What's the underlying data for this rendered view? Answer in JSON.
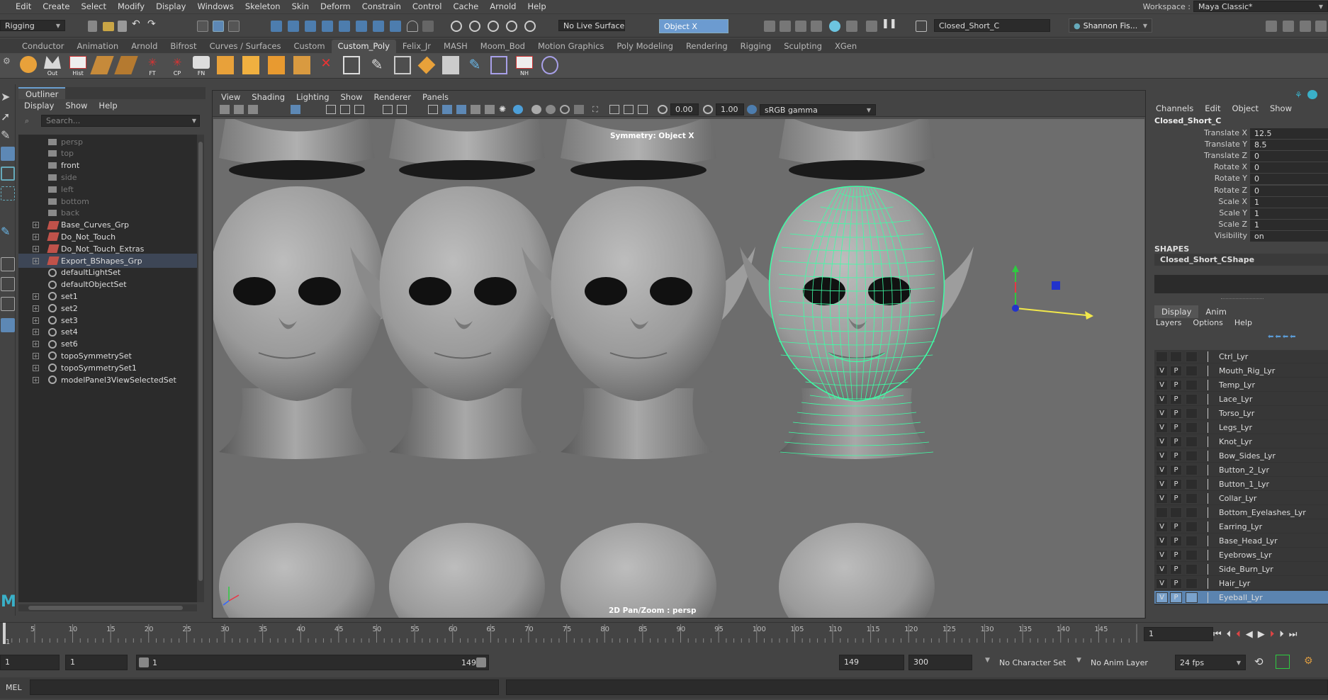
{
  "menubar": {
    "items": [
      "Edit",
      "Create",
      "Select",
      "Modify",
      "Display",
      "Windows",
      "Skeleton",
      "Skin",
      "Deform",
      "Constrain",
      "Control",
      "Cache",
      "Arnold",
      "Help"
    ],
    "workspace_label": "Workspace :",
    "workspace_value": "Maya Classic*"
  },
  "statusline": {
    "menuset": "Rigging",
    "live_surface": "No Live Surface",
    "symmetry": "Object X",
    "object_name": "Closed_Short_C",
    "user": "Shannon Fis..."
  },
  "shelf": {
    "tabs": [
      "Conductor",
      "Animation",
      "Arnold",
      "Bifrost",
      "Curves / Surfaces",
      "Custom",
      "Custom_Poly",
      "Felix_Jr",
      "MASH",
      "Moom_Bod",
      "Motion Graphics",
      "Poly Modeling",
      "Rendering",
      "Rigging",
      "Sculpting",
      "XGen"
    ],
    "active_tab": "Custom_Poly",
    "labels": {
      "out": "Out",
      "hist": "Hist",
      "ft": "FT",
      "cp": "CP",
      "fn": "FN",
      "nh": "NH"
    }
  },
  "outliner": {
    "title": "Outliner",
    "menu": [
      "Display",
      "Show",
      "Help"
    ],
    "search_placeholder": "Search...",
    "items": [
      {
        "label": "persp",
        "dim": true,
        "type": "camera",
        "expand": false
      },
      {
        "label": "top",
        "dim": true,
        "type": "camera",
        "expand": false
      },
      {
        "label": "front",
        "dim": false,
        "type": "camera",
        "expand": false
      },
      {
        "label": "side",
        "dim": true,
        "type": "camera",
        "expand": false
      },
      {
        "label": "left",
        "dim": true,
        "type": "camera",
        "expand": false
      },
      {
        "label": "bottom",
        "dim": true,
        "type": "camera",
        "expand": false
      },
      {
        "label": "back",
        "dim": true,
        "type": "camera",
        "expand": false
      },
      {
        "label": "Base_Curves_Grp",
        "dim": false,
        "type": "group",
        "expand": true
      },
      {
        "label": "Do_Not_Touch",
        "dim": false,
        "type": "group",
        "expand": true
      },
      {
        "label": "Do_Not_Touch_Extras",
        "dim": false,
        "type": "group",
        "expand": true
      },
      {
        "label": "Export_BShapes_Grp",
        "dim": false,
        "type": "group",
        "expand": true,
        "selected": true
      },
      {
        "label": "defaultLightSet",
        "dim": false,
        "type": "set",
        "expand": false
      },
      {
        "label": "defaultObjectSet",
        "dim": false,
        "type": "set",
        "expand": false
      },
      {
        "label": "set1",
        "dim": false,
        "type": "set",
        "expand": true
      },
      {
        "label": "set2",
        "dim": false,
        "type": "set",
        "expand": true
      },
      {
        "label": "set3",
        "dim": false,
        "type": "set",
        "expand": true
      },
      {
        "label": "set4",
        "dim": false,
        "type": "set",
        "expand": true
      },
      {
        "label": "set6",
        "dim": false,
        "type": "set",
        "expand": true
      },
      {
        "label": "topoSymmetrySet",
        "dim": false,
        "type": "set",
        "expand": true
      },
      {
        "label": "topoSymmetrySet1",
        "dim": false,
        "type": "set",
        "expand": true
      },
      {
        "label": "modelPanel3ViewSelectedSet",
        "dim": false,
        "type": "set",
        "expand": true
      }
    ]
  },
  "viewport": {
    "menu": [
      "View",
      "Shading",
      "Lighting",
      "Show",
      "Renderer",
      "Panels"
    ],
    "near_value": "0.00",
    "far_value": "1.00",
    "color_space": "sRGB gamma",
    "symmetry_hud": "Symmetry: Object X",
    "camera_hud": "2D Pan/Zoom : persp",
    "wire_color": "#3dffa6"
  },
  "channelbox": {
    "menu": [
      "Channels",
      "Edit",
      "Object",
      "Show"
    ],
    "object": "Closed_Short_C",
    "channels": [
      {
        "label": "Translate X",
        "value": "12.5"
      },
      {
        "label": "Translate Y",
        "value": "8.5"
      },
      {
        "label": "Translate Z",
        "value": "0"
      },
      {
        "label": "Rotate X",
        "value": "0"
      },
      {
        "label": "Rotate Y",
        "value": "0"
      },
      {
        "label": "Rotate Z",
        "value": "0"
      },
      {
        "label": "Scale X",
        "value": "1"
      },
      {
        "label": "Scale Y",
        "value": "1"
      },
      {
        "label": "Scale Z",
        "value": "1"
      },
      {
        "label": "Visibility",
        "value": "on"
      }
    ],
    "shapes_header": "SHAPES",
    "shape_name": "Closed_Short_CShape"
  },
  "layer_editor": {
    "tabs": [
      "Display",
      "Anim"
    ],
    "menu": [
      "Layers",
      "Options",
      "Help"
    ],
    "layers": [
      {
        "name": "Ctrl_Lyr",
        "v": "",
        "p": ""
      },
      {
        "name": "Mouth_Rig_Lyr",
        "v": "V",
        "p": "P"
      },
      {
        "name": "Temp_Lyr",
        "v": "V",
        "p": "P"
      },
      {
        "name": "Lace_Lyr",
        "v": "V",
        "p": "P"
      },
      {
        "name": "Torso_Lyr",
        "v": "V",
        "p": "P"
      },
      {
        "name": "Legs_Lyr",
        "v": "V",
        "p": "P"
      },
      {
        "name": "Knot_Lyr",
        "v": "V",
        "p": "P"
      },
      {
        "name": "Bow_Sides_Lyr",
        "v": "V",
        "p": "P"
      },
      {
        "name": "Button_2_Lyr",
        "v": "V",
        "p": "P"
      },
      {
        "name": "Button_1_Lyr",
        "v": "V",
        "p": "P"
      },
      {
        "name": "Collar_Lyr",
        "v": "V",
        "p": "P"
      },
      {
        "name": "Bottom_Eyelashes_Lyr",
        "v": "",
        "p": ""
      },
      {
        "name": "Earring_Lyr",
        "v": "V",
        "p": "P"
      },
      {
        "name": "Base_Head_Lyr",
        "v": "V",
        "p": "P"
      },
      {
        "name": "Eyebrows_Lyr",
        "v": "V",
        "p": "P"
      },
      {
        "name": "Side_Burn_Lyr",
        "v": "V",
        "p": "P"
      },
      {
        "name": "Hair_Lyr",
        "v": "V",
        "p": "P"
      },
      {
        "name": "Eyeball_Lyr",
        "v": "V",
        "p": "P",
        "selected": true
      }
    ]
  },
  "timeline": {
    "ticks": [
      "1",
      "5",
      "10",
      "15",
      "20",
      "25",
      "30",
      "35",
      "40",
      "45",
      "50",
      "55",
      "60",
      "65",
      "70",
      "75",
      "80",
      "85",
      "90",
      "95",
      "100",
      "105",
      "110",
      "115",
      "120",
      "125",
      "130",
      "135",
      "140",
      "145"
    ],
    "current_frame": "1",
    "range_start": "1",
    "range_start2": "1",
    "slider_start": "1",
    "slider_end": "149",
    "end": "149",
    "anim_end": "300",
    "character_set": "No Character Set",
    "anim_layer": "No Anim Layer",
    "fps": "24 fps"
  },
  "cmdline": {
    "label": "MEL"
  }
}
